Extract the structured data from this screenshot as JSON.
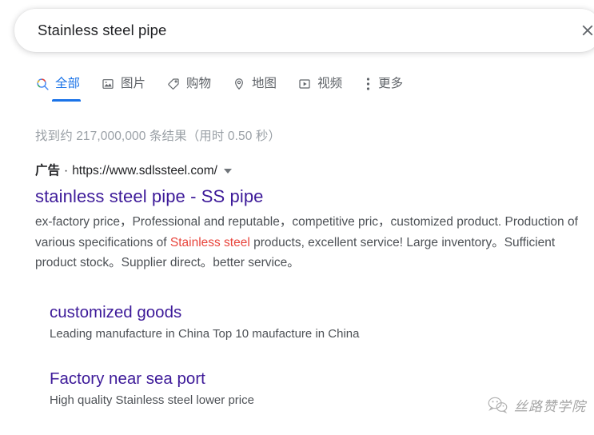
{
  "search": {
    "value": "Stainless steel pipe",
    "placeholder": "",
    "clear_icon": "close-icon"
  },
  "nav": {
    "items": [
      {
        "label": "全部",
        "icon": "google-search-icon",
        "active": true
      },
      {
        "label": "图片",
        "icon": "image-icon",
        "active": false
      },
      {
        "label": "购物",
        "icon": "tag-icon",
        "active": false
      },
      {
        "label": "地图",
        "icon": "map-pin-icon",
        "active": false
      },
      {
        "label": "视频",
        "icon": "video-play-icon",
        "active": false
      },
      {
        "label": "更多",
        "icon": "more-vertical-icon",
        "active": false
      }
    ]
  },
  "result_stats": "找到约 217,000,000 条结果（用时 0.50 秒）",
  "ad": {
    "badge": "广告",
    "separator": "·",
    "url": "https://www.sdlssteel.com/",
    "caret_icon": "chevron-down-icon",
    "title": "stainless steel pipe - SS pipe",
    "description_parts": [
      {
        "text": "ex-factory price，Professional and reputable，competitive pric，customized product. Production of various specifications of ",
        "highlight": false
      },
      {
        "text": "Stainless steel",
        "highlight": true
      },
      {
        "text": " products, excellent service! Large inventory。Sufficient product stock。Supplier direct。better service。",
        "highlight": false
      }
    ],
    "sitelinks": [
      {
        "title": "customized goods",
        "description": "Leading manufacture in China Top 10 maufacture in China"
      },
      {
        "title": "Factory near sea port",
        "description": "High quality Stainless steel lower price"
      }
    ]
  },
  "watermark": {
    "text": "丝路赞学院",
    "logo_icon": "wechat-icon"
  },
  "colors": {
    "link": "#3d1a99",
    "accent": "#1a73e8",
    "highlight": "#e8453c",
    "muted": "#9aa0a6",
    "body_text": "#4d5156"
  }
}
